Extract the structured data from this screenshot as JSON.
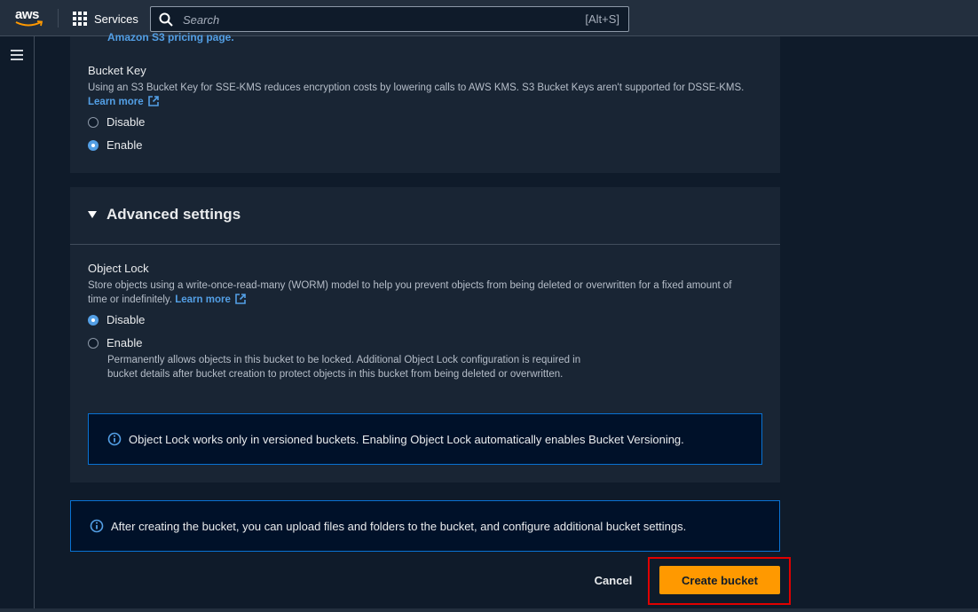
{
  "topnav": {
    "logo_text": "aws",
    "services_label": "Services",
    "search_placeholder": "Search",
    "search_shortcut": "[Alt+S]"
  },
  "bucket_key": {
    "clipped_link": "Amazon S3 pricing page.",
    "title": "Bucket Key",
    "description": "Using an S3 Bucket Key for SSE-KMS reduces encryption costs by lowering calls to AWS KMS. S3 Bucket Keys aren't supported for DSSE-KMS.",
    "learn_more": "Learn more",
    "options": [
      {
        "label": "Disable",
        "selected": false
      },
      {
        "label": "Enable",
        "selected": true
      }
    ]
  },
  "advanced": {
    "title": "Advanced settings",
    "object_lock": {
      "title": "Object Lock",
      "description": "Store objects using a write-once-read-many (WORM) model to help you prevent objects from being deleted or overwritten for a fixed amount of time or indefinitely.",
      "learn_more": "Learn more",
      "options": [
        {
          "label": "Disable",
          "selected": true
        },
        {
          "label": "Enable",
          "selected": false,
          "description": "Permanently allows objects in this bucket to be locked. Additional Object Lock configuration is required in bucket details after bucket creation to protect objects in this bucket from being deleted or overwritten."
        }
      ],
      "info": "Object Lock works only in versioned buckets. Enabling Object Lock automatically enables Bucket Versioning."
    }
  },
  "footer_info": "After creating the bucket, you can upload files and folders to the bucket, and configure additional bucket settings.",
  "actions": {
    "cancel": "Cancel",
    "create": "Create bucket"
  },
  "colors": {
    "accent": "#539fe5",
    "primary_button": "#ff9900",
    "highlight": "#e00000",
    "info_border": "#0972d3"
  }
}
